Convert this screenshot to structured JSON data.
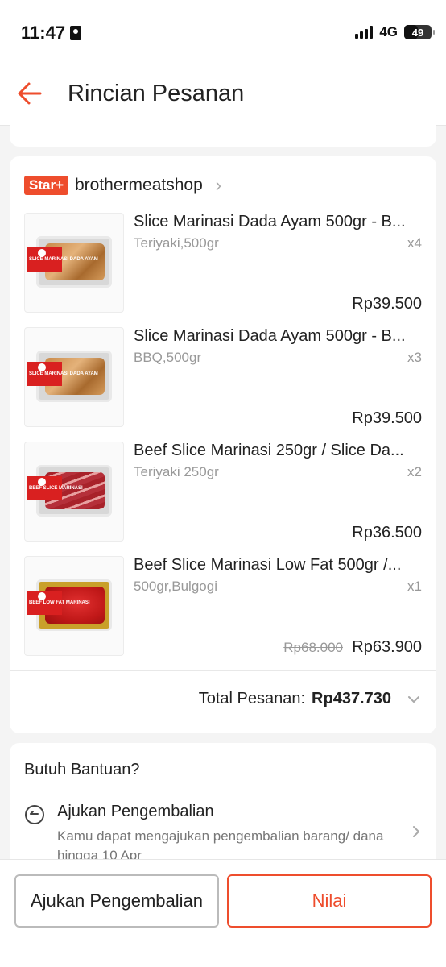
{
  "status_bar": {
    "time": "11:47",
    "network": "4G",
    "battery": "49",
    "battery_level_percent": 49
  },
  "header": {
    "title": "Rincian Pesanan"
  },
  "shop": {
    "badge": "Star+",
    "name": "brothermeatshop"
  },
  "products": [
    {
      "name": "Slice Marinasi Dada Ayam 500gr - B...",
      "variant": "Teriyaki,500gr",
      "qty": "x4",
      "price": "Rp39.500",
      "label": "SLICE MARINASI DADA AYAM"
    },
    {
      "name": "Slice Marinasi Dada Ayam 500gr - B...",
      "variant": "BBQ,500gr",
      "qty": "x3",
      "price": "Rp39.500",
      "label": "SLICE MARINASI DADA AYAM"
    },
    {
      "name": "Beef Slice Marinasi 250gr / Slice Da...",
      "variant": "Teriyaki 250gr",
      "qty": "x2",
      "price": "Rp36.500",
      "label": "BEEF SLICE MARINASI"
    },
    {
      "name": "Beef Slice Marinasi Low Fat 500gr /...",
      "variant": "500gr,Bulgogi",
      "qty": "x1",
      "original_price": "Rp68.000",
      "price": "Rp63.900",
      "label": "BEEF LOW FAT MARINASI"
    }
  ],
  "total": {
    "label": "Total Pesanan:",
    "value": "Rp437.730"
  },
  "help": {
    "title": "Butuh Bantuan?",
    "return_title": "Ajukan Pengembalian",
    "return_desc": "Kamu dapat mengajukan pengembalian barang/ dana hingga 10 Apr"
  },
  "actions": {
    "return_button": "Ajukan Pengembalian",
    "rate_button": "Nilai"
  },
  "colors": {
    "brand": "#ee4d2d",
    "muted": "#999999"
  }
}
